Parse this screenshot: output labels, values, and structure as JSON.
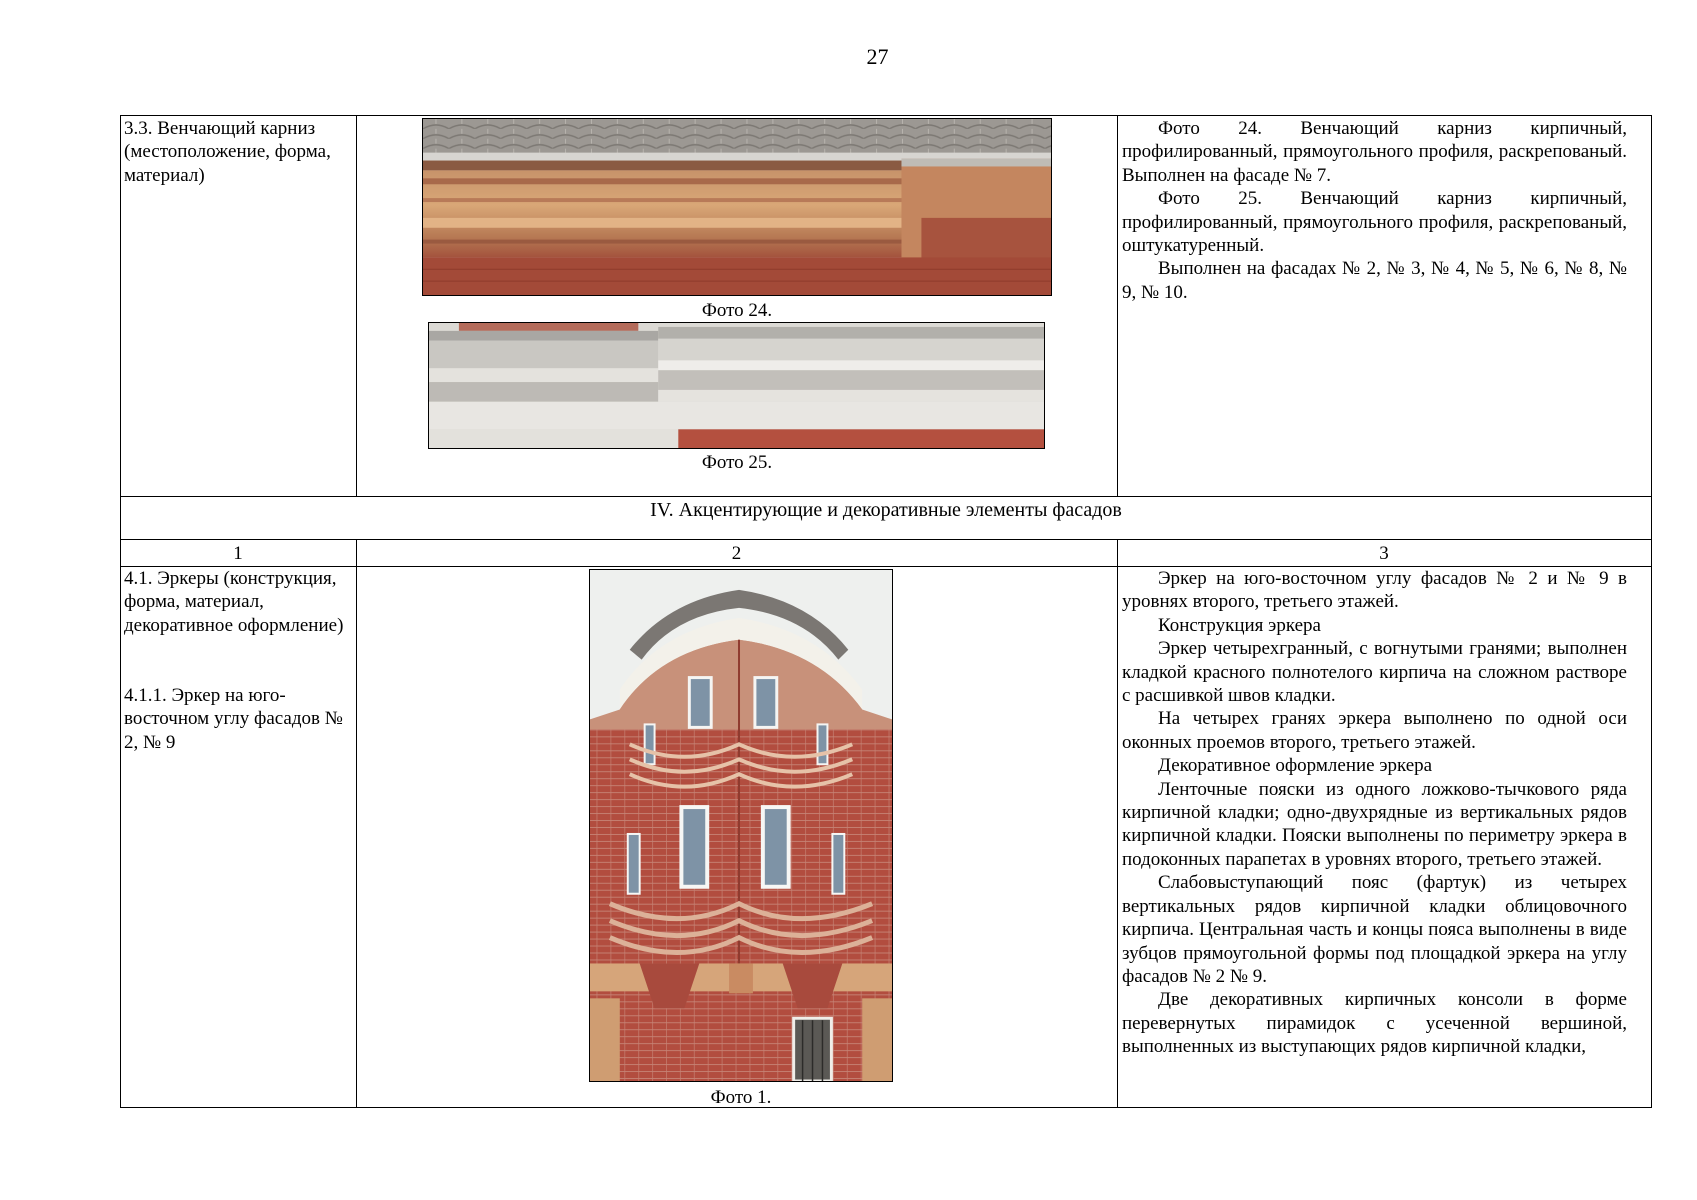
{
  "page_number": "27",
  "section_33": {
    "title": "3.3. Венчающий карниз (местоположение, форма, материал)",
    "photo24_caption": "Фото 24.",
    "photo25_caption": "Фото 25.",
    "desc": [
      "Фото 24. Венчающий карниз кирпичный, профилированный, прямоугольного профиля, раскрепованый. Выполнен на фасаде № 7.",
      "Фото 25. Венчающий карниз кирпичный, профилированный, прямоугольного профиля, раскрепованый, оштукатуренный.",
      "Выполнен на фасадах № 2, № 3, № 4, № 5, № 6, № 8, № 9, № 10."
    ]
  },
  "section_iv": {
    "heading": "IV.  Акцентирующие и декоративные элементы фасадов",
    "col_headers": [
      "1",
      "2",
      "3"
    ]
  },
  "section_41": {
    "title": "4.1. Эркеры (конструкция, форма, материал, декоративное оформление)",
    "subtitle": "4.1.1. Эркер на юго-восточном углу  фасадов № 2, № 9",
    "photo1_caption": "Фото 1.",
    "desc": [
      "Эркер на юго-восточном углу фасадов № 2 и № 9 в уровнях второго, третьего этажей.",
      "Конструкция эркера",
      "Эркер четырехгранный, с вогнутыми гранями; выполнен кладкой красного полнотелого кирпича на сложном растворе с расшивкой швов кладки.",
      "На четырех гранях эркера выполнено по одной оси оконных проемов второго, третьего этажей.",
      "Декоративное оформление эркера",
      "Ленточные пояски из одного ложково-тычкового ряда кирпичной кладки; одно-двухрядные из вертикальных рядов кирпичной кладки. Пояски выполнены по периметру эркера в подоконных парапетах в уровнях второго, третьего этажей.",
      "Слабовыступающий пояс (фартук) из четырех вертикальных рядов кирпичной кладки облицовочного кирпича. Центральная часть и концы пояса выполнены в виде зубцов прямоугольной формы под площадкой эркера на углу фасадов № 2 № 9.",
      "Две декоративных кирпичных консоли в форме перевернутых пирамидок с усеченной вершиной, выполненных из выступающих рядов кирпичной кладки,"
    ]
  }
}
